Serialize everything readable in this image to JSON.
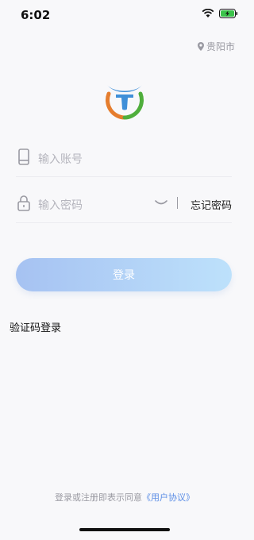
{
  "status": {
    "time": "6:02"
  },
  "location": {
    "city": "贵阳市"
  },
  "form": {
    "account_placeholder": "输入账号",
    "password_placeholder": "输入密码",
    "forgot_label": "忘记密码",
    "login_label": "登录"
  },
  "alt_login": {
    "sms_label": "验证码登录"
  },
  "agreement": {
    "prefix": "登录或注册即表示同意",
    "link": "《用户协议》"
  },
  "icons": {
    "status": [
      "wifi-icon",
      "battery-charging-icon"
    ],
    "location": "location-pin-icon",
    "account": "phone-icon",
    "password": "lock-icon",
    "toggle": "eye-closed-icon"
  },
  "colors": {
    "accent": "#5c8ee6",
    "button_gradient": [
      "#a6c2f2",
      "#bde1fb"
    ],
    "logo": [
      "#3f8fd8",
      "#e57d2e",
      "#4fae3c"
    ],
    "battery": "#3bc34a"
  }
}
